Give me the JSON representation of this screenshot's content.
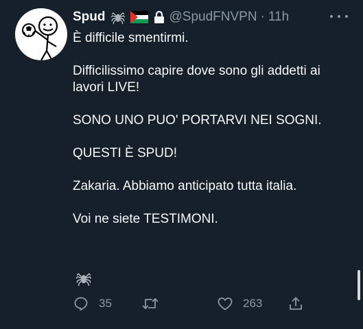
{
  "tweet": {
    "author_name": "Spud",
    "handle": "@SpudFNVPN",
    "separator": "·",
    "time": "11h",
    "lines": [
      "È difficile smentirmi.",
      "Difficilissimo capire dove sono gli addetti ai lavori LIVE!",
      "SONO UNO PUO' PORTARVI NEI SOGNI.",
      "QUESTI È SPUD!",
      "Zakaria.  Abbiamo anticipato tutta italia.",
      "Voi ne siete TESTIMONI."
    ],
    "header_icons": [
      "spider-icon",
      "palestine-flag-icon",
      "lock-icon"
    ],
    "footer_icon": "spider-icon"
  },
  "actions": {
    "replies": "35",
    "retweets": "",
    "likes": "263"
  },
  "colors": {
    "background": "#15202b",
    "text": "#f7f9f9",
    "secondary": "#8b98a5"
  }
}
